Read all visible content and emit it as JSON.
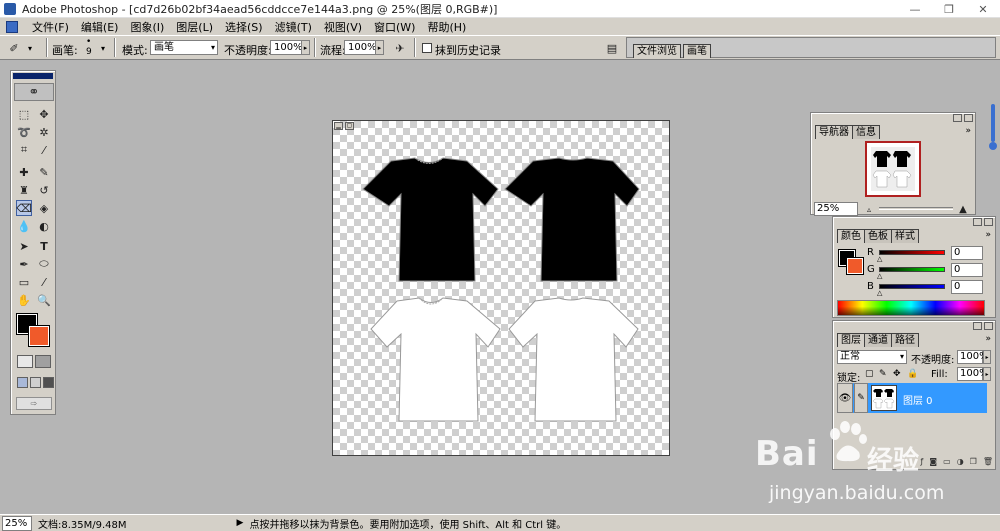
{
  "window": {
    "title": "Adobe Photoshop - [cd7d26b02bf34aead56cddcce7e144a3.png @ 25%(图层 0,RGB#)]",
    "controls": [
      "—",
      "❐",
      "✕"
    ]
  },
  "menubar": {
    "items": [
      "文件(F)",
      "编辑(E)",
      "图象(I)",
      "图层(L)",
      "选择(S)",
      "滤镜(T)",
      "视图(V)",
      "窗口(W)",
      "帮助(H)"
    ]
  },
  "options": {
    "brush_label": "画笔:",
    "brush_size": "9",
    "mode_label": "模式:",
    "mode_value": "画笔",
    "opacity_label": "不透明度:",
    "opacity_value": "100%",
    "flow_label": "流程:",
    "flow_value": "100%",
    "erase_history_label": "抹到历史记录",
    "well_tabs": [
      "文件浏览",
      "画笔"
    ]
  },
  "navigator": {
    "tabs": [
      "导航器",
      "信息"
    ],
    "zoom": "25%"
  },
  "color": {
    "tabs": [
      "颜色",
      "色板",
      "样式"
    ],
    "channels": [
      {
        "name": "R",
        "value": "0",
        "color": "#cc0000"
      },
      {
        "name": "G",
        "value": "0",
        "color": "#00aa00"
      },
      {
        "name": "B",
        "value": "0",
        "color": "#0000cc"
      }
    ],
    "foreground": "#000000",
    "background": "#f05a2a"
  },
  "layers": {
    "tabs": [
      "图层",
      "通道",
      "路径"
    ],
    "blend_mode": "正常",
    "opacity_label": "不透明度:",
    "opacity_value": "100%",
    "lock_label": "锁定:",
    "fill_label": "Fill:",
    "fill_value": "100%",
    "items": [
      {
        "name": "图层 0",
        "selected": true
      }
    ]
  },
  "status": {
    "zoom": "25%",
    "doc_size": "文档:8.35M/9.48M",
    "hint": "点按并拖移以抹为背景色。要用附加选项，使用 Shift、Alt 和 Ctrl 键。"
  },
  "watermark": {
    "brand": "Bai",
    "brand_tail": "经验",
    "url": "jingyan.baidu.com"
  }
}
